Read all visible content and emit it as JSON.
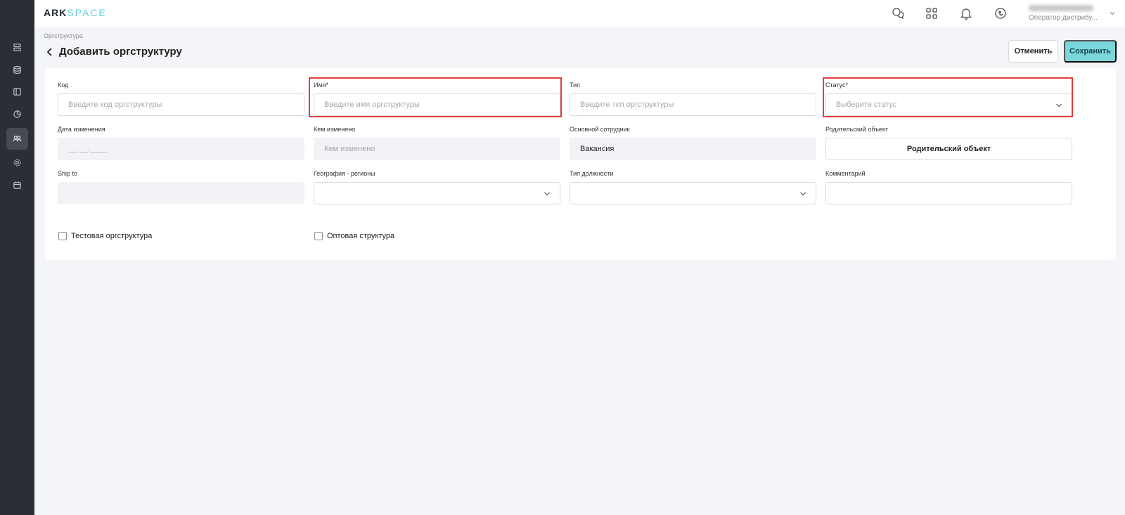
{
  "app": {
    "logo_ark": "ARK",
    "logo_space": "SPACE"
  },
  "sidebar": {
    "items": [
      {
        "icon": "server-icon"
      },
      {
        "icon": "database-icon"
      },
      {
        "icon": "layout-icon"
      },
      {
        "icon": "pie-chart-icon"
      },
      {
        "icon": "users-icon",
        "active": true
      },
      {
        "icon": "gear-icon"
      },
      {
        "icon": "calendar-icon"
      }
    ]
  },
  "user": {
    "role": "Оператор дистрибу..."
  },
  "breadcrumb": "Оргструктура",
  "page_title": "Добавить оргструктуру",
  "actions": {
    "cancel": "Отменить",
    "save": "Сохранить"
  },
  "form": {
    "code": {
      "label": "Код",
      "placeholder": "Введите код оргструктуры"
    },
    "name": {
      "label": "Имя*",
      "placeholder": "Введите имя оргструктуры"
    },
    "type": {
      "label": "Тип",
      "placeholder": "Введите тип оргструктуры"
    },
    "status": {
      "label": "Статус*",
      "placeholder": "Выберите статус"
    },
    "changed_date": {
      "label": "Дата изменения",
      "value": "__.__.____"
    },
    "changed_by": {
      "label": "Кем изменено",
      "placeholder": "Кем изменено"
    },
    "main_employee": {
      "label": "Основной сотрудник",
      "value": "Вакансия"
    },
    "parent": {
      "label": "Родительский объект",
      "button": "Родительский объект"
    },
    "ship_to": {
      "label": "Ship to",
      "value": ""
    },
    "geography": {
      "label": "География - регионы",
      "value": ""
    },
    "position_type": {
      "label": "Тип должности",
      "value": ""
    },
    "comment": {
      "label": "Комментарий",
      "value": ""
    },
    "test_structure": {
      "label": "Тестовая оргструктура",
      "checked": false
    },
    "wholesale_structure": {
      "label": "Оптовая структура",
      "checked": false
    }
  },
  "colors": {
    "accent": "#79d6db",
    "sidebar": "#2b2e35",
    "highlight": "#e53e3e"
  }
}
